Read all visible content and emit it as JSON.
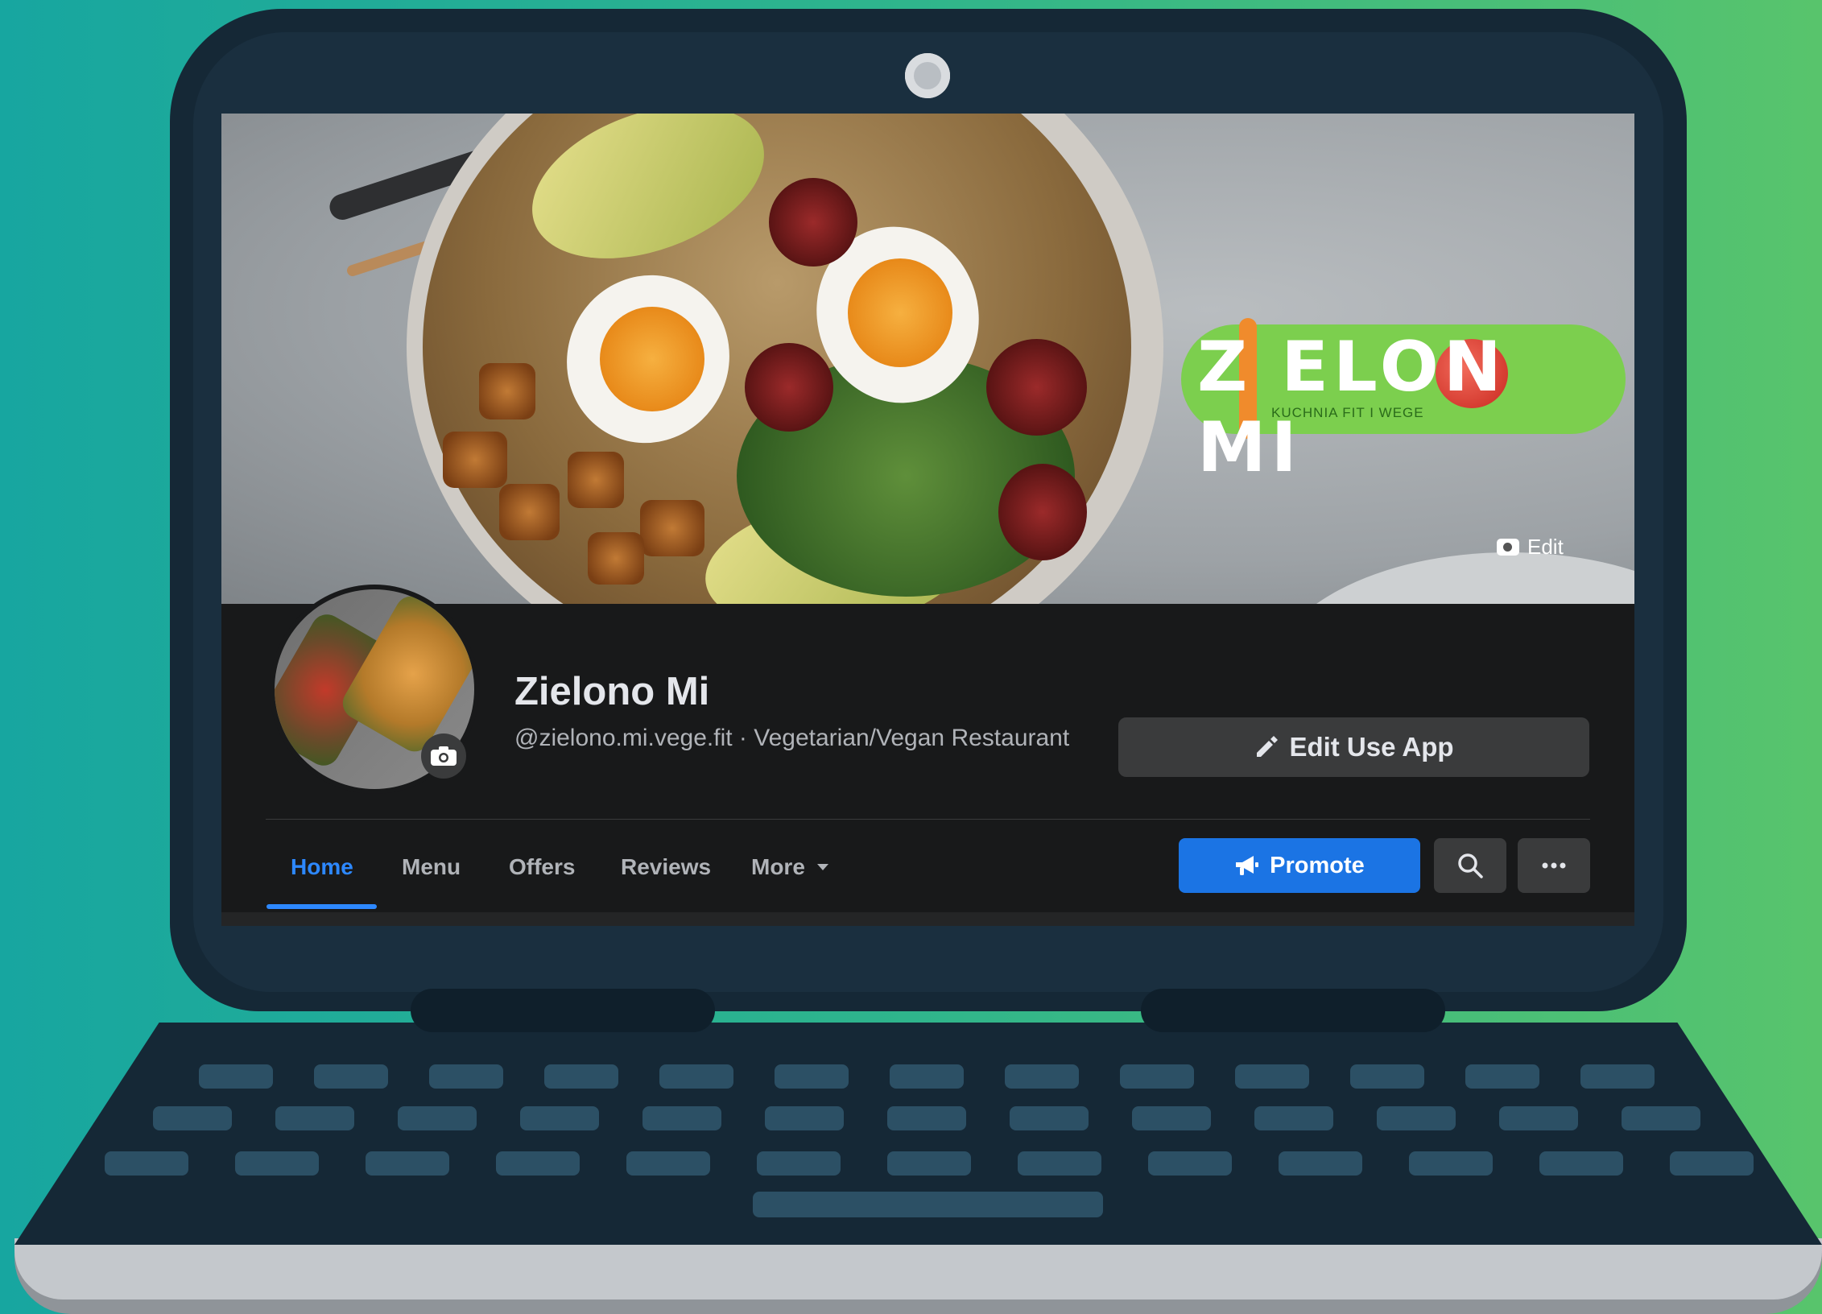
{
  "page": {
    "name": "Zielono Mi",
    "subtitle": "@zielono.mi.vege.fit · Vegetarian/Vegan Restaurant",
    "edit_button_label": "Edit Use App",
    "cover_edit_label": "Edit"
  },
  "logo": {
    "text": "Z ELON MI",
    "tagline": "KUCHNIA FIT I WEGE"
  },
  "tabs": [
    {
      "label": "Home",
      "active": true
    },
    {
      "label": "Menu",
      "active": false
    },
    {
      "label": "Offers",
      "active": false
    },
    {
      "label": "Reviews",
      "active": false
    },
    {
      "label": "More",
      "active": false
    }
  ],
  "actions": {
    "promote_label": "Promote",
    "search_icon": "search-icon",
    "more_icon": "ellipsis-icon"
  },
  "colors": {
    "accent": "#2d88ff",
    "promote": "#1b74e4",
    "background": "#18191a",
    "logo_green": "#7ccf4e"
  }
}
